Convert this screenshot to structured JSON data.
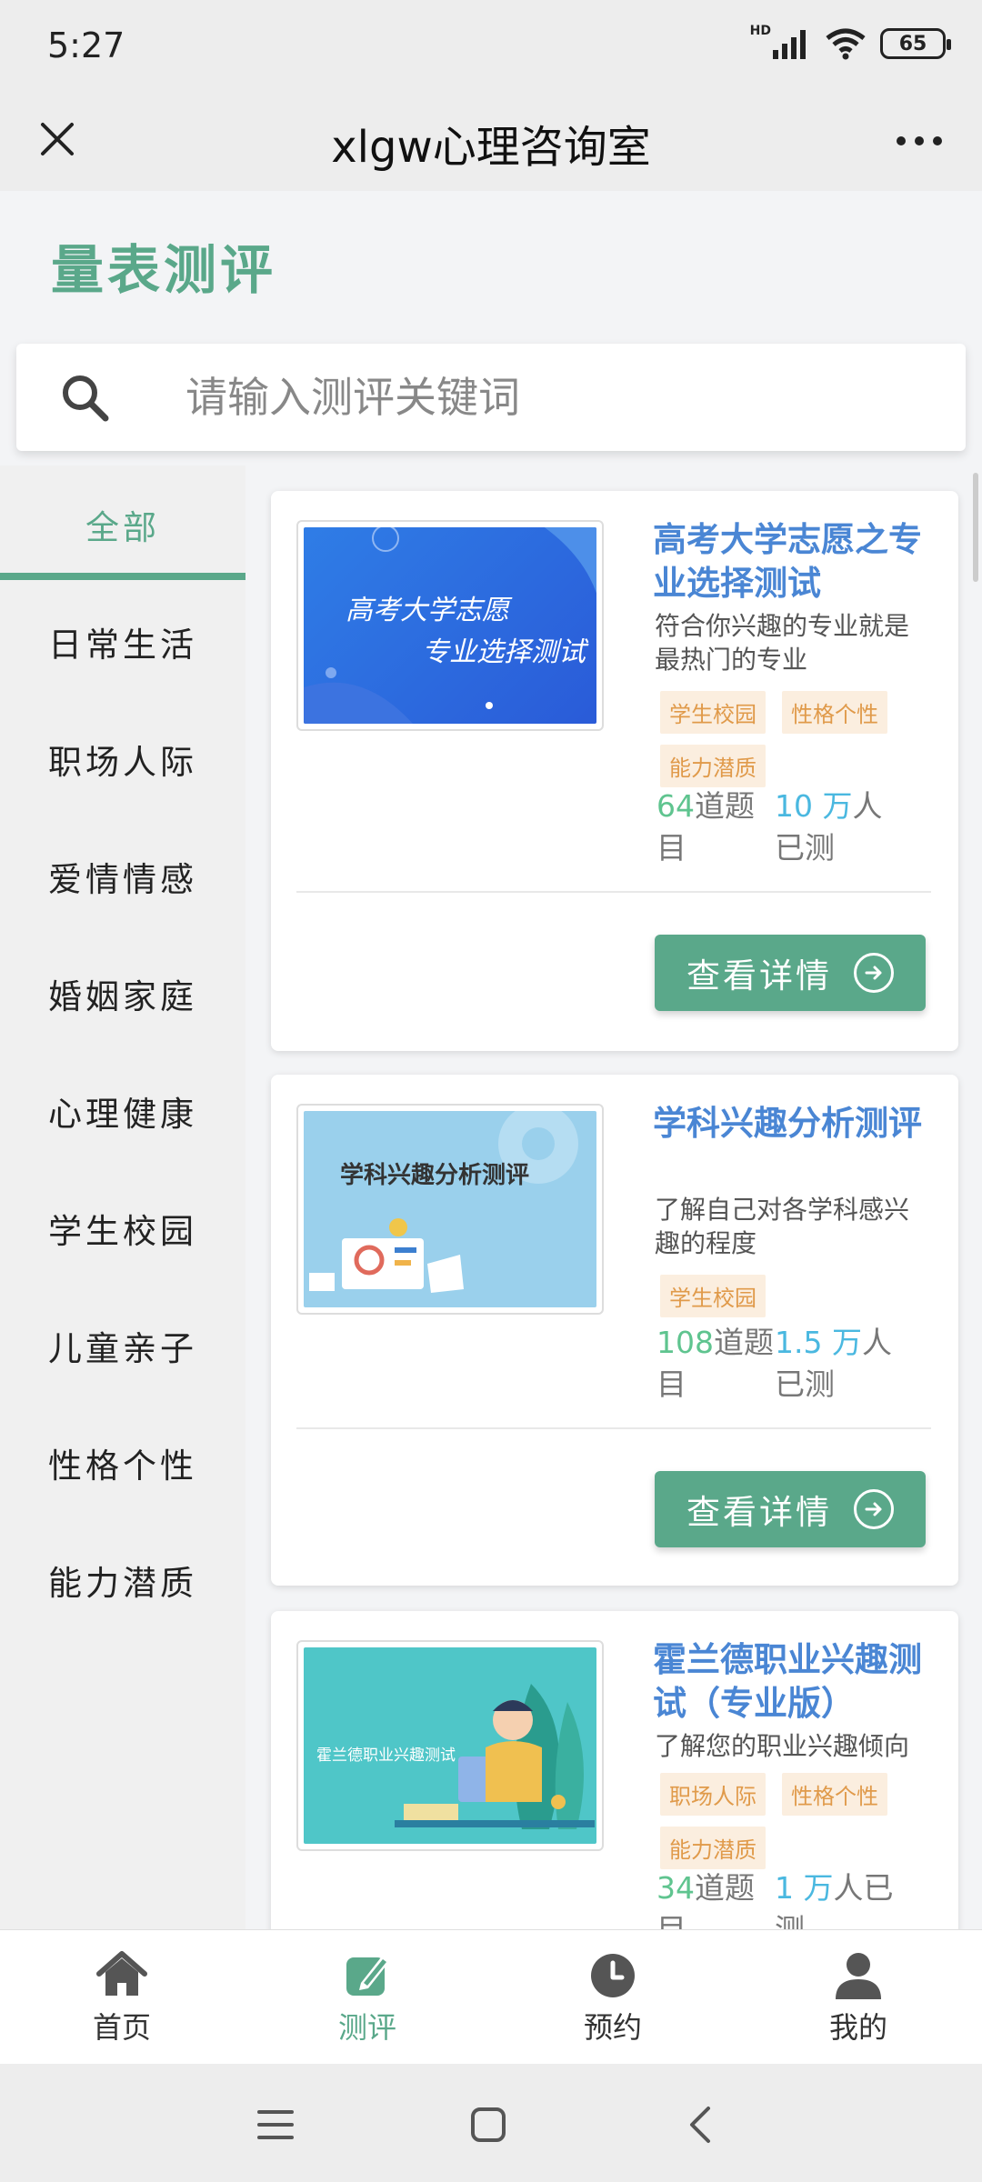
{
  "status_bar": {
    "time": "5:27",
    "network": "HD",
    "battery": "65"
  },
  "title_bar": {
    "title": "xlgw心理咨询室"
  },
  "page": {
    "heading": "量表测评"
  },
  "search": {
    "placeholder": "请输入测评关键词"
  },
  "sidebar": {
    "items": [
      {
        "label": "全部"
      },
      {
        "label": "日常生活"
      },
      {
        "label": "职场人际"
      },
      {
        "label": "爱情情感"
      },
      {
        "label": "婚姻家庭"
      },
      {
        "label": "心理健康"
      },
      {
        "label": "学生校园"
      },
      {
        "label": "儿童亲子"
      },
      {
        "label": "性格个性"
      },
      {
        "label": "能力潜质"
      }
    ]
  },
  "cards": [
    {
      "title": "高考大学志愿之专业选择测试",
      "description": "符合你兴趣的专业就是最热门的专业",
      "tags": [
        "学生校园",
        "性格个性",
        "能力潜质"
      ],
      "question_count": "64",
      "question_unit": "道题目",
      "tested_count": "10 万",
      "tested_unit": "人已测",
      "thumb_text_line1": "高考大学志愿",
      "thumb_text_line2": "专业选择测试",
      "button_label": "查看详情"
    },
    {
      "title": "学科兴趣分析测评",
      "description": "了解自己对各学科感兴趣的程度",
      "tags": [
        "学生校园"
      ],
      "question_count": "108",
      "question_unit": "道题目",
      "tested_count": "1.5 万",
      "tested_unit": "人已测",
      "thumb_text": "学科兴趣分析测评",
      "button_label": "查看详情"
    },
    {
      "title": "霍兰德职业兴趣测试（专业版）",
      "description": "了解您的职业兴趣倾向",
      "tags": [
        "职场人际",
        "性格个性",
        "能力潜质"
      ],
      "question_count": "34",
      "question_unit": "道题目",
      "tested_count": "1 万",
      "tested_unit": "人已测",
      "thumb_text": "霍兰德职业兴趣测试"
    }
  ],
  "bottom_nav": {
    "items": [
      {
        "label": "首页",
        "icon": "home-icon"
      },
      {
        "label": "测评",
        "icon": "edit-icon"
      },
      {
        "label": "预约",
        "icon": "clock-icon"
      },
      {
        "label": "我的",
        "icon": "user-icon"
      }
    ]
  },
  "colors": {
    "accent": "#5aa88a",
    "title_blue": "#4a86d4",
    "tag_orange": "#e09a4a",
    "tag_bg": "#fbeedf"
  }
}
